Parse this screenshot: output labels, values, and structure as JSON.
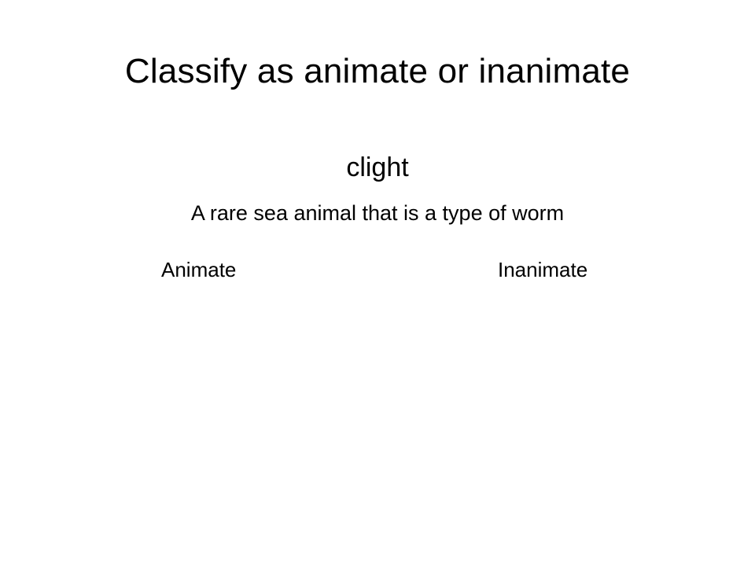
{
  "slide": {
    "title": "Classify as animate or inanimate",
    "word": "clight",
    "definition": "A rare sea animal that is a type of worm",
    "choices": {
      "animate": "Animate",
      "inanimate": "Inanimate"
    },
    "colors": {
      "background": "#ffffff",
      "text": "#000000"
    }
  }
}
